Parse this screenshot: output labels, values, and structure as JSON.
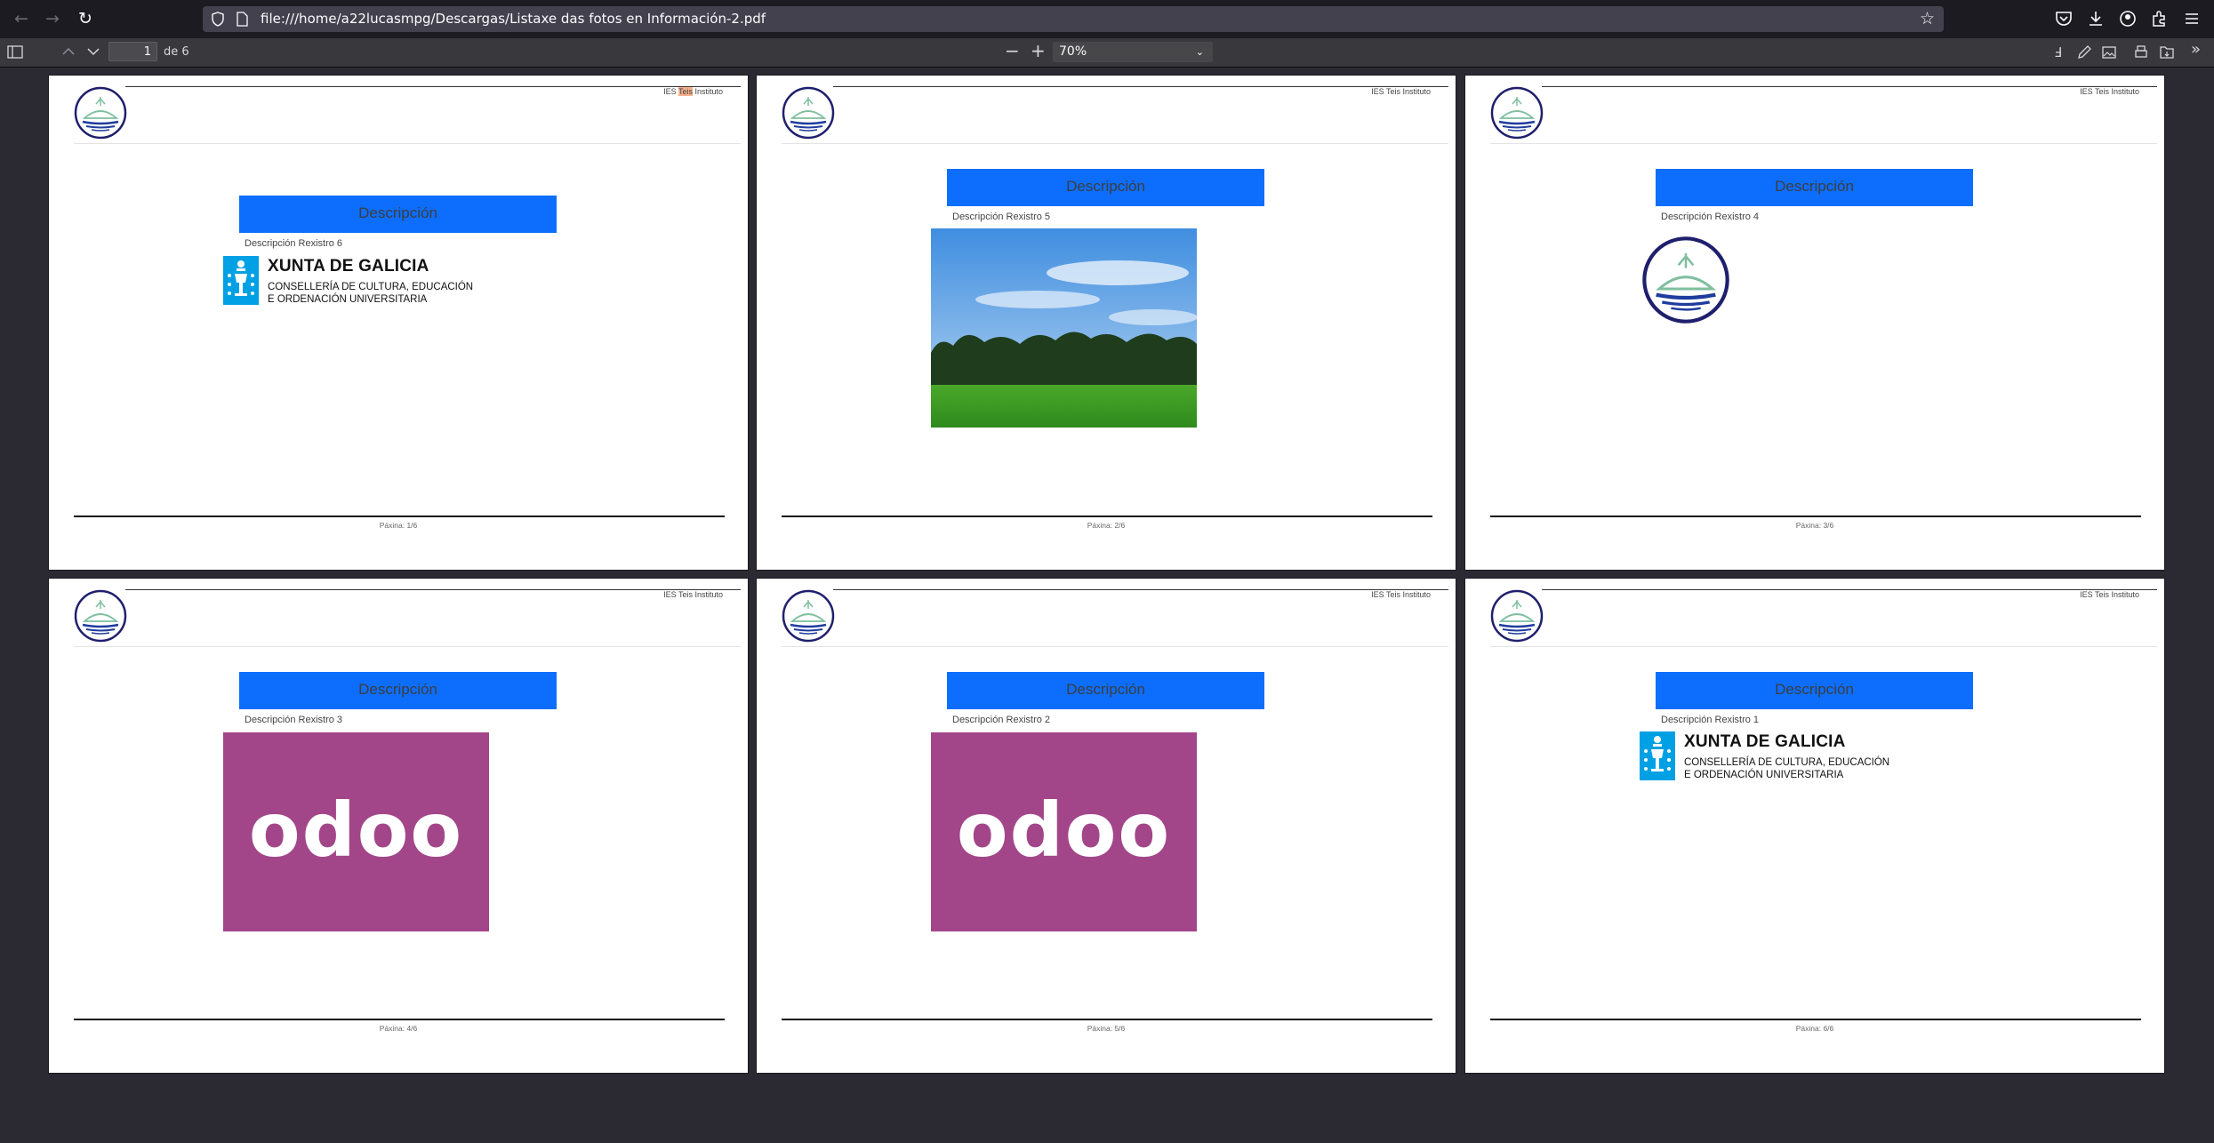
{
  "browser": {
    "url": "file:///home/a22lucasmpg/Descargas/Listaxe das fotos en Información-2.pdf"
  },
  "pdf_toolbar": {
    "page_number": "1",
    "page_count": "de 6",
    "zoom": "70%"
  },
  "document": {
    "header_text_a": "IES ",
    "header_text_highlight": "Teis",
    "header_text_b": " Instituto",
    "header_text_full": "IES Teis Instituto",
    "description_heading": "Descripción",
    "pages": [
      {
        "record": "Descripción Rexistro 6",
        "footer": "Páxina: 1/6",
        "image": "xunta-logo"
      },
      {
        "record": "Descripción Rexistro 5",
        "footer": "Páxina: 2/6",
        "image": "landscape-photo"
      },
      {
        "record": "Descripción Rexistro 4",
        "footer": "Páxina: 3/6",
        "image": "ies-teis-logo"
      },
      {
        "record": "Descripción Rexistro 3",
        "footer": "Páxina: 4/6",
        "image": "odoo-logo"
      },
      {
        "record": "Descripción Rexistro 2",
        "footer": "Páxina: 5/6",
        "image": "odoo-logo"
      },
      {
        "record": "Descripción Rexistro 1",
        "footer": "Páxina: 6/6",
        "image": "xunta-logo"
      }
    ],
    "xunta": {
      "title": "XUNTA DE GALICIA",
      "line1": "CONSELLERÍA DE CULTURA, EDUCACIÓN",
      "line2": "E ORDENACIÓN UNIVERSITARIA"
    },
    "odoo_text": "odoo"
  },
  "colors": {
    "description_box": "#0d6efd",
    "odoo_bg": "#a24689",
    "xunta_blue": "#00a0e4"
  }
}
